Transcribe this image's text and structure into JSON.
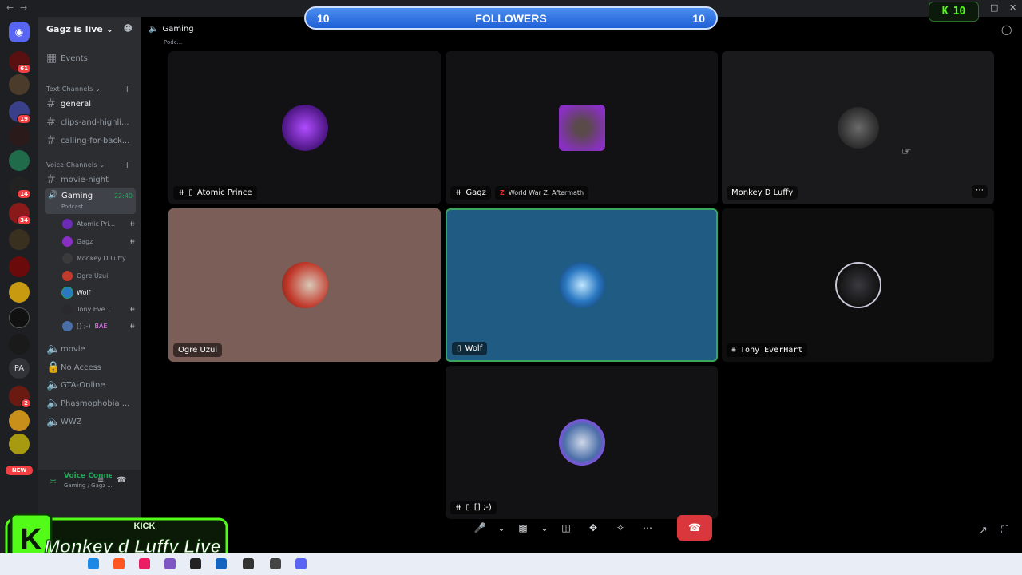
{
  "overlay": {
    "followers_left": "10",
    "followers_title": "FOLLOWERS",
    "followers_right": "10",
    "kick_count": "10",
    "kick_logo": "K",
    "banner_label": "KICK",
    "banner_text": "Monkey d Luffy Live"
  },
  "rail": {
    "badges": [
      "61",
      "19",
      "14",
      "34",
      "2"
    ],
    "pa_label": "PA",
    "new_label": "NEW"
  },
  "sidebar": {
    "guild_name": "Gagz is live",
    "events_label": "Events",
    "text_category": "Text Channels",
    "text_channels": [
      "general",
      "clips-and-highli...",
      "calling-for-back..."
    ],
    "voice_category": "Voice Channels",
    "voice_channels_top": [
      "movie-night"
    ],
    "active_voice": {
      "name": "Gaming",
      "timer": "22:40",
      "subtitle": "Podcast"
    },
    "voice_users": [
      "Atomic Pri...",
      "Gagz",
      "Monkey D Luffy",
      "Ogre Uzui",
      "Wolf",
      "Tony Eve...",
      "[] ;-)"
    ],
    "voice_users_extra": [
      "",
      "",
      "",
      "",
      "",
      "",
      "BAE"
    ],
    "voice_channels_bottom": [
      "movie",
      "No Access",
      "GTA-Online",
      "Phasmophobia ...",
      "WWZ"
    ],
    "voice_status": "Voice Connected",
    "voice_status_sub": "Gaming / Gagz ..."
  },
  "main": {
    "channel_title": "Gaming",
    "channel_sub": "Podc..."
  },
  "tiles": [
    {
      "name": "Atomic Prince",
      "muted": true,
      "mobile": true,
      "color": "#121214",
      "avatar": "#6b2bb8"
    },
    {
      "name": "Gagz",
      "muted": true,
      "mobile": false,
      "activity": "World War Z: Aftermath",
      "color": "#121214",
      "avatar": "#8a2fc4"
    },
    {
      "name": "Monkey D Luffy",
      "muted": false,
      "mobile": false,
      "color": "#1a1a1c",
      "avatar": "#3a3a3a"
    },
    {
      "name": "Ogre Uzui",
      "muted": false,
      "mobile": false,
      "color": "#7a5e57",
      "avatar": "#c23a2c"
    },
    {
      "name": "Wolf",
      "muted": false,
      "mobile": true,
      "color": "#1f5b82",
      "avatar": "#2a78c2"
    },
    {
      "name": "Tony EverHart",
      "muted": true,
      "mobile": false,
      "color": "#0e0e0e",
      "avatar": "#2a2a2e"
    },
    {
      "name": "[] ;-)",
      "muted": true,
      "mobile": true,
      "color": "#121214",
      "avatar": "#4a6ea8"
    }
  ],
  "colors": {
    "speaking_border": "#3ba55d",
    "hangup": "#da373c",
    "kick_green": "#53fc18",
    "followers_blue": "#2f73e6"
  }
}
